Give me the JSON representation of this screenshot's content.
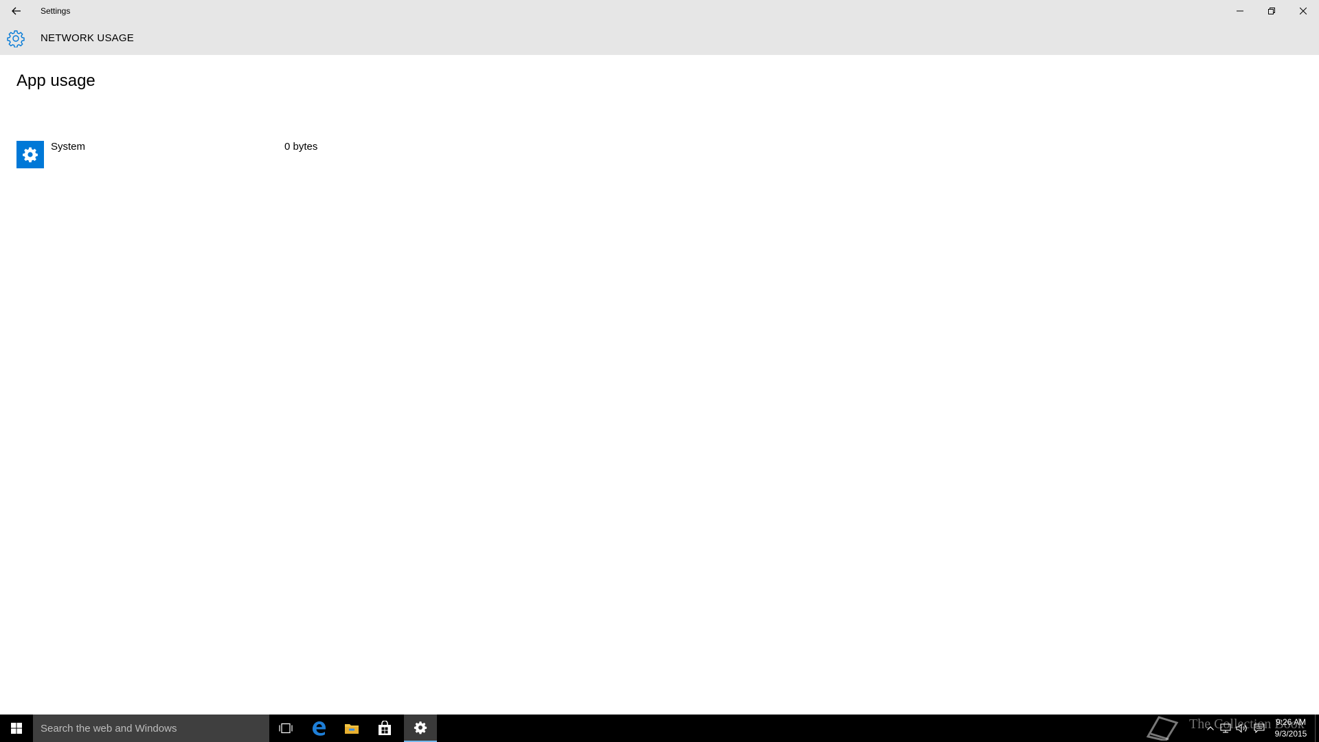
{
  "window": {
    "title": "Settings",
    "controls": [
      "minimize",
      "restore",
      "close"
    ]
  },
  "header": {
    "title": "NETWORK USAGE",
    "icon": "gear-icon"
  },
  "main": {
    "section_title": "App usage",
    "apps": [
      {
        "name": "System",
        "usage": "0 bytes",
        "icon": "gear-icon",
        "icon_color": "#0078d7"
      }
    ]
  },
  "taskbar": {
    "search_placeholder": "Search the web and Windows",
    "pinned": [
      "task-view-icon",
      "edge-icon",
      "file-explorer-icon",
      "store-icon",
      "settings-icon"
    ],
    "active_app": "settings-icon",
    "clock_time": "9:26 AM",
    "clock_date": "9/3/2015",
    "watermark": "The Collection Book"
  },
  "colors": {
    "accent": "#0078d7",
    "header_bg": "#e6e6e6",
    "taskbar_bg": "#000000"
  }
}
